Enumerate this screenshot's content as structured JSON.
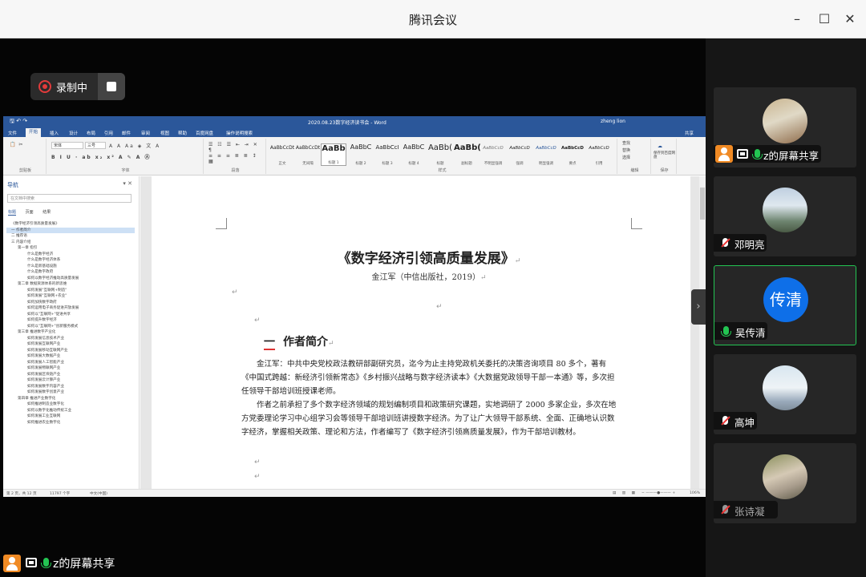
{
  "app": {
    "title": "腾讯会议",
    "window_controls": [
      "minimize-icon",
      "maximize-icon",
      "close-icon"
    ]
  },
  "recording": {
    "label": "录制中"
  },
  "word": {
    "doc_title": "2020.08.23数字经济读书会 - Word",
    "user": "zheng lion",
    "tabs": [
      "文件",
      "开始",
      "插入",
      "设计",
      "布局",
      "引用",
      "邮件",
      "审阅",
      "视图",
      "帮助",
      "百度网盘",
      "操作说明搜索",
      "共享"
    ],
    "active_tab": "开始",
    "ribbon": {
      "font_name": "宋体",
      "font_size": "三号",
      "group_labels": [
        "剪贴板",
        "字体",
        "段落",
        "样式",
        "编辑",
        "保存"
      ],
      "styles": [
        {
          "sample": "AaBbCcDt",
          "name": "正文"
        },
        {
          "sample": "AaBbCcDt",
          "name": "无间隔"
        },
        {
          "sample": "AaBb",
          "name": "标题 1"
        },
        {
          "sample": "AaBbC",
          "name": "标题 2"
        },
        {
          "sample": "AaBbCcI",
          "name": "标题 3"
        },
        {
          "sample": "AaBbC",
          "name": "标题 4"
        },
        {
          "sample": "AaBb(",
          "name": "标题"
        },
        {
          "sample": "AaBb(",
          "name": "副标题"
        },
        {
          "sample": "AaBbCcD",
          "name": "不明显强调"
        },
        {
          "sample": "AaBbCcD",
          "name": "强调"
        },
        {
          "sample": "AaBbCcD",
          "name": "明显强调"
        },
        {
          "sample": "AaBbCcD",
          "name": "要点"
        },
        {
          "sample": "AaBbCcD",
          "name": "引用"
        }
      ],
      "edit_items": [
        "查找",
        "替换",
        "选择"
      ],
      "save_label": "保存到百度网盘"
    },
    "nav": {
      "header": "导航",
      "search_placeholder": "在文档中搜索",
      "tabs": [
        "标题",
        "页面",
        "结果"
      ],
      "items": [
        {
          "text": "《数字经济引领高质量发展》",
          "level": 1
        },
        {
          "text": "一 作者简介",
          "level": 1,
          "selected": true
        },
        {
          "text": "二 推荐语",
          "level": 1
        },
        {
          "text": "三 内容介绍",
          "level": 1
        },
        {
          "text": "第一章 指引",
          "level": 2
        },
        {
          "text": "什么是数字经济",
          "level": 3
        },
        {
          "text": "什么是数字经济体系",
          "level": 3
        },
        {
          "text": "什么是新基础设施",
          "level": 3
        },
        {
          "text": "什么是数字政府",
          "level": 3
        },
        {
          "text": "如何以数字经济推动高质量发展",
          "level": 3
        },
        {
          "text": "第二章 数据资源体系的新思维",
          "level": 2
        },
        {
          "text": "如何发展\"互联网+制造\"",
          "level": 3
        },
        {
          "text": "如何发展\"互联网+农业\"",
          "level": 3
        },
        {
          "text": "如何加快数字政府",
          "level": 3
        },
        {
          "text": "如何运用电子商务促进开放发展",
          "level": 3
        },
        {
          "text": "如何以\"互联网+\"促进共享",
          "level": 3
        },
        {
          "text": "如何提升数字经济",
          "level": 3
        },
        {
          "text": "如何以\"互联网+\"创新服务模式",
          "level": 3
        },
        {
          "text": "第三章 推进数字产业化",
          "level": 2
        },
        {
          "text": "如何发展信息技术产业",
          "level": 3
        },
        {
          "text": "如何发展互联网产业",
          "level": 3
        },
        {
          "text": "如何发展移动互联网产业",
          "level": 3
        },
        {
          "text": "如何发展大数据产业",
          "level": 3
        },
        {
          "text": "如何发展人工智能产业",
          "level": 3
        },
        {
          "text": "如何发展物联网产业",
          "level": 3
        },
        {
          "text": "如何发展区块链产业",
          "level": 3
        },
        {
          "text": "如何发展云计算产业",
          "level": 3
        },
        {
          "text": "如何发展数字内容产业",
          "level": 3
        },
        {
          "text": "如何发展数字创意产业",
          "level": 3
        },
        {
          "text": "第四章 推进产业数字化",
          "level": 2
        },
        {
          "text": "如何推进制造业数字化",
          "level": 3
        },
        {
          "text": "如何以数字化推动传统工业",
          "level": 3
        },
        {
          "text": "如何发展工业互联网",
          "level": 3
        },
        {
          "text": "如何推进农业数字化",
          "level": 3
        }
      ]
    },
    "document": {
      "title": "《数字经济引领高质量发展》",
      "subtitle": "金江军（中信出版社，2019）",
      "section_num": "一",
      "section_title": "作者简介",
      "para1": "金江军：中共中央党校政法教研部副研究员，迄今为止主持党政机关委托的决策咨询项目 80 多个，著有《中国式跨越：新经济引领新常态》《乡村振兴战略与数字经济读本》《大数据党政领导干部一本通》等，多次担任领导干部培训班授课老师。",
      "para2": "作者之前承担了多个数字经济领域的规划编制项目和政策研究课题，实地调研了 2000 多家企业，多次在地方党委理论学习中心组学习会等领导干部培训班讲授数字经济。为了让广大领导干部系统、全面、正确地认识数字经济，掌握相关政策、理论和方法，作者编写了《数字经济引领高质量发展》，作为干部培训教材。"
    },
    "status": {
      "page": "第 2 页，共 12 页",
      "words": "11797 个字",
      "lang": "中文(中国)",
      "zoom": "106%"
    }
  },
  "presenter_label": "z的屏幕共享",
  "participants": [
    {
      "name": "z的屏幕共享",
      "avatar": "avatar-photo-icon",
      "mic": "on",
      "presenter": true
    },
    {
      "name": "邓明亮",
      "avatar": "avatar-photo-icon",
      "mic": "muted"
    },
    {
      "name": "吴传清",
      "avatar_text": "传清",
      "mic": "on",
      "active": true
    },
    {
      "name": "高坤",
      "avatar": "avatar-photo-icon",
      "mic": "muted"
    },
    {
      "name": "张诗凝",
      "avatar": "avatar-photo-icon",
      "mic": "muted"
    }
  ],
  "colors": {
    "speaking": "#23c552",
    "word_blue": "#2b579a",
    "avatar_blue": "#0e6fe8",
    "rec_red": "#e23b3b"
  }
}
